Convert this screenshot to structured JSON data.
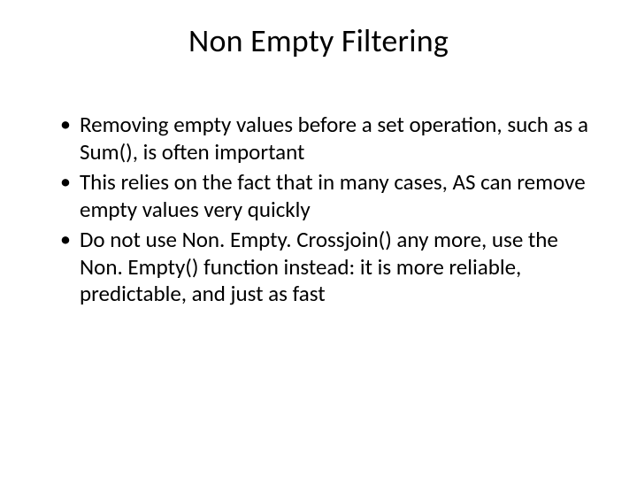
{
  "slide": {
    "title": "Non Empty Filtering",
    "bullets": [
      "Removing empty values before a set operation, such as a Sum(), is often important",
      "This relies on the fact that in many cases, AS can remove empty values very quickly",
      "Do not use Non. Empty. Crossjoin() any more, use the Non. Empty() function instead: it is more reliable, predictable, and just as fast"
    ]
  }
}
